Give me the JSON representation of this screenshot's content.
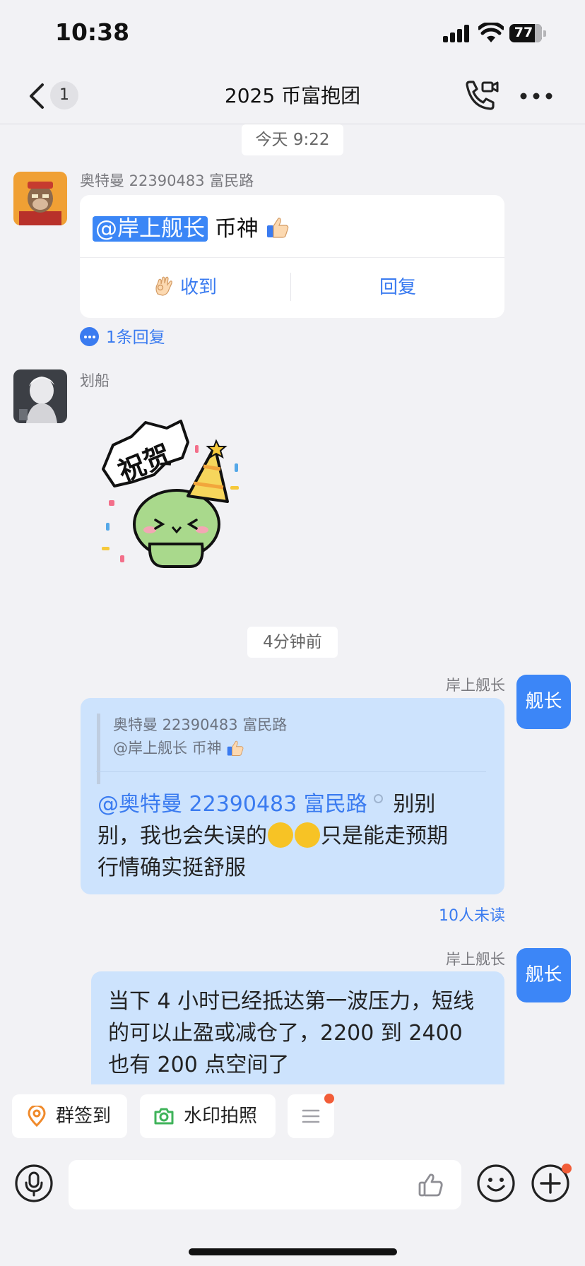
{
  "status_bar": {
    "time": "10:38",
    "battery": "77"
  },
  "nav": {
    "unread_count": "1",
    "title": "2025 币富抱团"
  },
  "messages": {
    "divider_1": "今天 9:22",
    "msg1": {
      "sender": "奥特曼 22390483 富民路",
      "mention": "@岸上舰长",
      "text": " 币神",
      "ack_label": "收到",
      "reply_label": "回复",
      "reply_count": "1条回复"
    },
    "msg2": {
      "sender": "划船",
      "sticker_text": "祝贺"
    },
    "divider_2": "4分钟前",
    "msg3": {
      "sender": "岸上舰长",
      "avatar_text": "舰长",
      "quote_author": "奥特曼 22390483 富民路",
      "quote_text": "@岸上舰长 币神",
      "mention": "@奥特曼 22390483 富民路",
      "text_a": "别别",
      "text_b": "别，我也会失误的",
      "text_c": "只是能走预期",
      "text_d": "行情确实挺舒服",
      "read_status": "10人未读"
    },
    "msg4": {
      "sender": "岸上舰长",
      "avatar_text": "舰长",
      "text": "当下 4 小时已经抵达第一波压力，短线的可以止盈或减仓了，2200 到 2400 也有 200 点空间了"
    }
  },
  "quick_actions": {
    "checkin_label": "群签到",
    "camera_label": "水印拍照"
  },
  "input": {
    "placeholder": ""
  },
  "colors": {
    "accent": "#3a7bf0",
    "self_bubble": "#cde3fd",
    "background": "#f2f2f5",
    "badge": "#f25d38"
  },
  "icons": [
    "back-icon",
    "call-icon",
    "more-icon",
    "thumbs-up-icon",
    "ok-hand-icon",
    "comment-icon",
    "location-icon",
    "camera-icon",
    "menu-icon",
    "voice-icon",
    "emoji-icon",
    "plus-icon"
  ]
}
